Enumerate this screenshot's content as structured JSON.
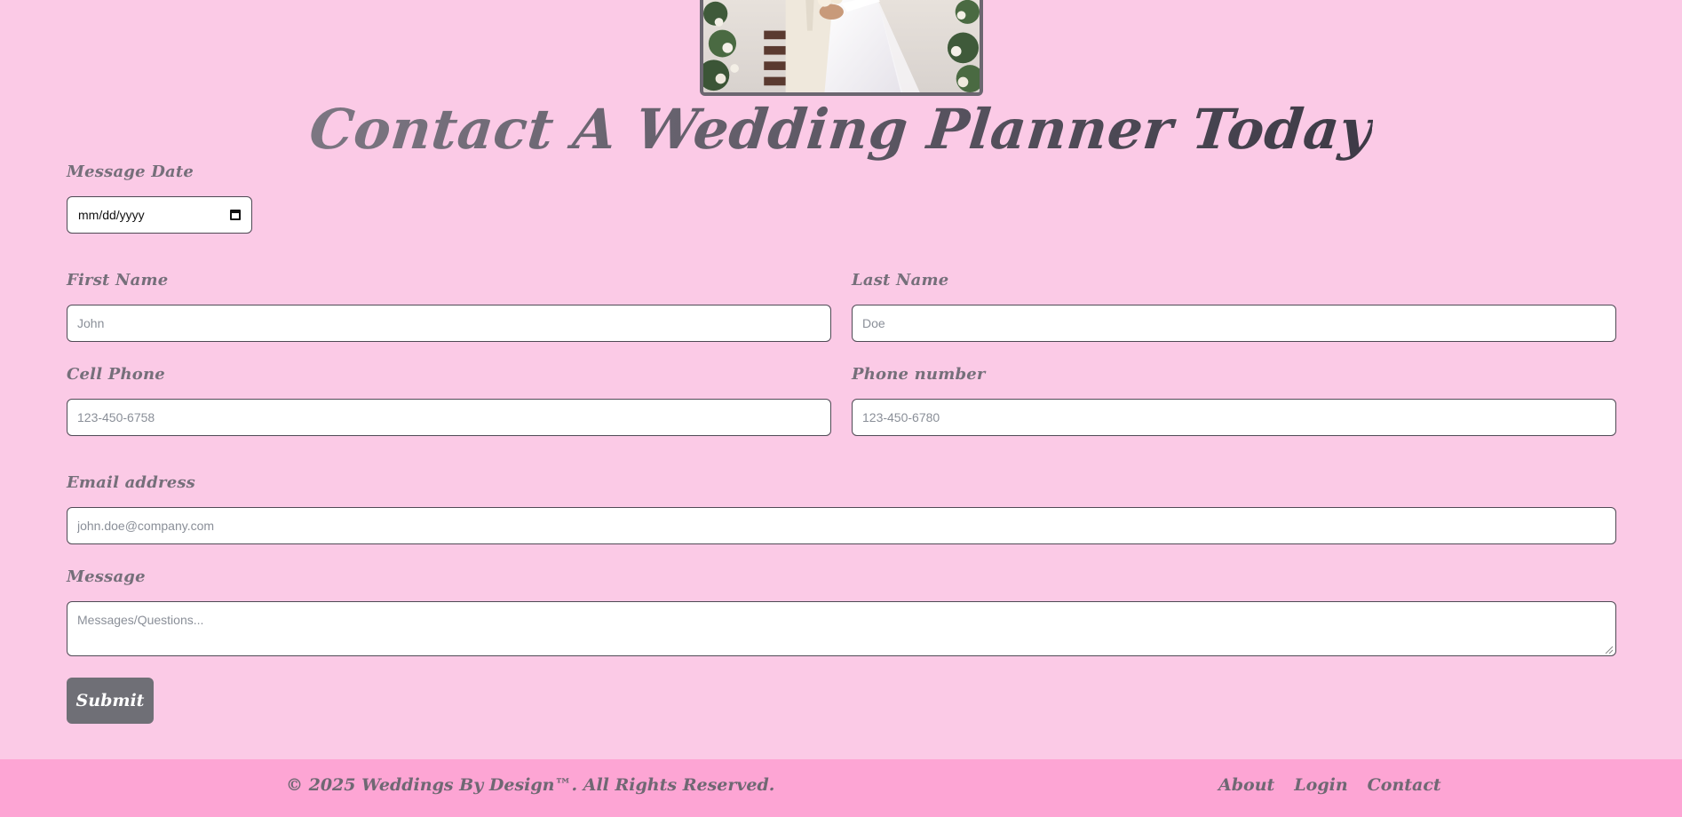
{
  "hero": {
    "image_alt": "Wedding couple photo"
  },
  "page": {
    "title": "Contact A Wedding Planner Today"
  },
  "form": {
    "message_date": {
      "label": "Message Date",
      "value": "mm/dd/yyyy"
    },
    "first_name": {
      "label": "First Name",
      "placeholder": "John"
    },
    "last_name": {
      "label": "Last Name",
      "placeholder": "Doe"
    },
    "cell_phone": {
      "label": "Cell Phone",
      "placeholder": "123-450-6758"
    },
    "phone_number": {
      "label": "Phone number",
      "placeholder": "123-450-6780"
    },
    "email": {
      "label": "Email address",
      "placeholder": "john.doe@company.com"
    },
    "message": {
      "label": "Message",
      "placeholder": "Messages/Questions..."
    },
    "submit_label": "Submit"
  },
  "footer": {
    "copyright": "© 2025 Weddings By Design™. All Rights Reserved.",
    "links": [
      {
        "label": "About"
      },
      {
        "label": "Login"
      },
      {
        "label": "Contact"
      }
    ]
  },
  "colors": {
    "background": "#fbcae6",
    "footer": "#fda5d4",
    "button": "#6f6f76",
    "label": "#756f7a"
  }
}
